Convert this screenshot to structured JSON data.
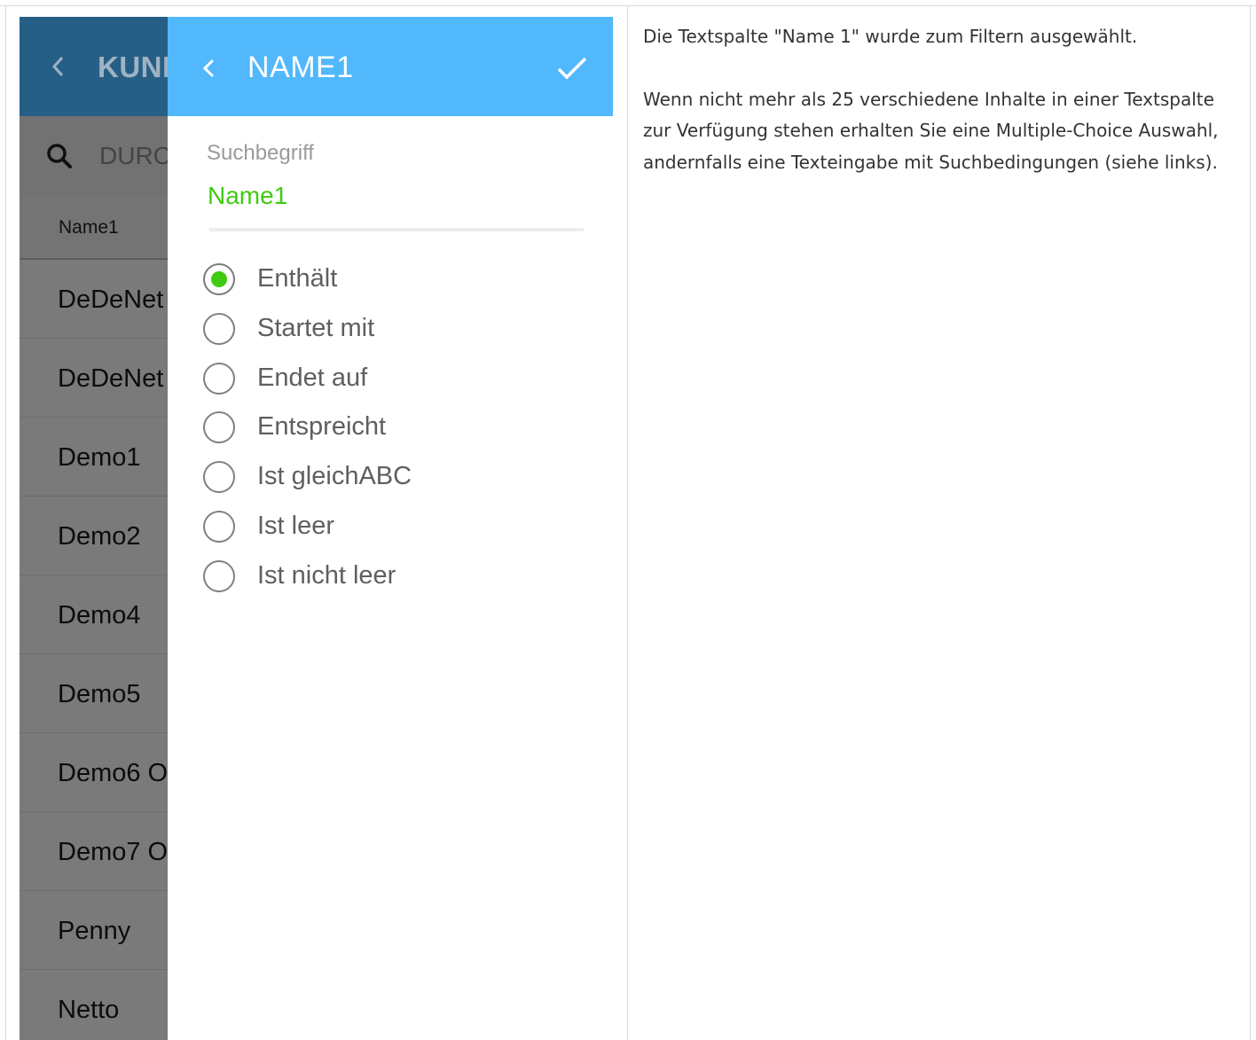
{
  "background_list": {
    "header_title": "KUND",
    "search_placeholder": "DURC",
    "column_header": "Name1",
    "rows": [
      {
        "label": "DeDeNet"
      },
      {
        "label": "DeDeNet"
      },
      {
        "label": "Demo1"
      },
      {
        "label": "Demo2"
      },
      {
        "label": "Demo4"
      },
      {
        "label": "Demo5"
      },
      {
        "label": "Demo6 O"
      },
      {
        "label": "Demo7 O"
      },
      {
        "label": "Penny"
      },
      {
        "label": "Netto"
      }
    ]
  },
  "dialog": {
    "title": "NAME1",
    "search_label": "Suchbegriff",
    "search_value": "Name1",
    "options": [
      {
        "label": "Enthält",
        "checked": true
      },
      {
        "label": "Startet mit",
        "checked": false
      },
      {
        "label": "Endet auf",
        "checked": false
      },
      {
        "label": "Entspreicht",
        "checked": false
      },
      {
        "label": "Ist gleichABC",
        "checked": false
      },
      {
        "label": "Ist leer",
        "checked": false
      },
      {
        "label": "Ist nicht leer",
        "checked": false
      }
    ]
  },
  "description": {
    "paragraph1": "Die Textspalte \"Name 1\" wurde zum Filtern ausgewählt.",
    "paragraph2": "Wenn nicht mehr als 25 verschiedene Inhalte in einer Textspalte zur Verfügung stehen erhalten Sie eine Multiple-Choice Auswahl, andernfalls eine Texteingabe mit Suchbedingungen (siehe links)."
  },
  "colors": {
    "dialog_header": "#51b8fc",
    "background_header": "#265f86",
    "accent_green": "#3fcb12",
    "overlay_gray": "#7a7a7a"
  }
}
